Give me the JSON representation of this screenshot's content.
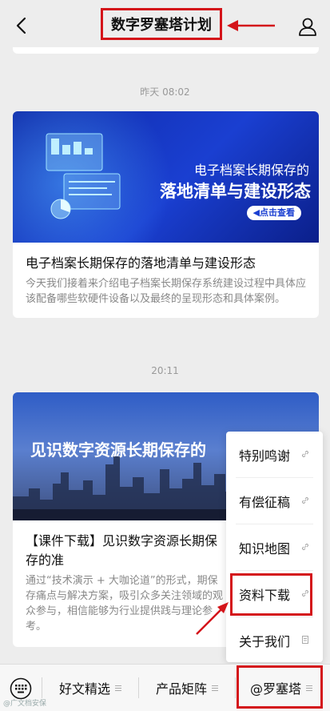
{
  "header": {
    "title": "数字罗塞塔计划",
    "back_icon": "chevron-left-icon",
    "user_icon": "user-icon"
  },
  "annotation_color": "#d4141a",
  "messages": [
    {
      "time": "昨天 08:02",
      "banner_subtitle": "电子档案长期保存的",
      "banner_title": "落地清单与建设形态",
      "banner_button": "◀点击查看",
      "title": "电子档案长期保存的落地清单与建设形态",
      "desc": "今天我们接着来介绍电子档案长期保存系统建设过程中具体应该配备哪些软硬件设备以及最终的呈现形态和具体案例。"
    },
    {
      "time": "20:11",
      "banner_title": "见识数字资源长期保存的",
      "title": "【课件下载】见识数字资源长期保存的准",
      "desc": "通过“技术演示 + 大咖论道”的形式，期保存痛点与解决方案，吸引众多关注领域的观众参与，相信能够为行业提供践与理论参考。"
    }
  ],
  "popup_menu": {
    "items": [
      "特别鸣谢",
      "有偿征稿",
      "知识地图",
      "资料下载",
      "关于我们"
    ],
    "highlighted": "资料下载"
  },
  "bottom_bar": {
    "keyboard_icon": "keyboard-icon",
    "tabs": [
      "好文精选",
      "产品矩阵",
      "@罗塞塔"
    ]
  },
  "watermark": "@广文档安保"
}
